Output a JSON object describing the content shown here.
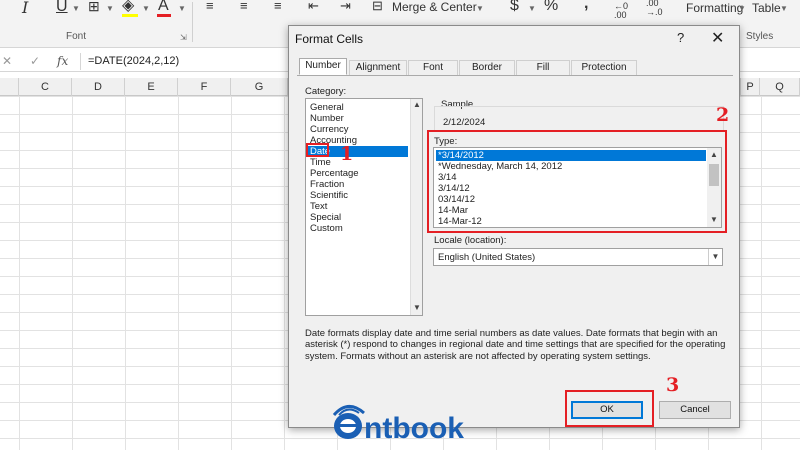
{
  "ribbon": {
    "font_group_label": "Font",
    "bold_icon": "I",
    "underline_icon": "U",
    "font_color_icon": "A",
    "merge_label": "Merge & Center",
    "currency_symbol": "$",
    "percent_symbol": "%",
    "comma_symbol": "̩,",
    "inc_decimal": ".00",
    "dec_decimal": ".00",
    "formatting_label": "Formatting",
    "table_label": "Table",
    "styles_label": "Styles"
  },
  "formula_bar": {
    "cancel_icon": "✕",
    "enter_icon": "✓",
    "fx_label": "fx",
    "formula": "=DATE(2024,2,12)"
  },
  "columns": [
    "C",
    "D",
    "E",
    "F",
    "G",
    "P",
    "Q"
  ],
  "dialog": {
    "title": "Format Cells",
    "help": "?",
    "close": "✕",
    "tabs": [
      "Number",
      "Alignment",
      "Font",
      "Border",
      "Fill",
      "Protection"
    ],
    "category_label": "Category:",
    "categories": [
      "General",
      "Number",
      "Currency",
      "Accounting",
      "Date",
      "Time",
      "Percentage",
      "Fraction",
      "Scientific",
      "Text",
      "Special",
      "Custom"
    ],
    "selected_category": "Date",
    "sample_label": "Sample",
    "sample_value": "2/12/2024",
    "type_label": "Type:",
    "types": [
      "*3/14/2012",
      "*Wednesday, March 14, 2012",
      "3/14",
      "3/14/12",
      "03/14/12",
      "14-Mar",
      "14-Mar-12"
    ],
    "locale_label": "Locale (location):",
    "locale_value": "English (United States)",
    "description": "Date formats display date and time serial numbers as date values.  Date formats that begin with an asterisk (*) respond to changes in regional date and time settings that are specified for the operating system. Formats without an asterisk are not affected by operating system settings.",
    "ok_label": "OK",
    "cancel_label": "Cancel"
  },
  "annotations": {
    "step1": "1",
    "step2": "2",
    "step3": "3",
    "color": "#e41f24"
  },
  "watermark": {
    "brand": "ntbook",
    "color": "#1a5fb4"
  }
}
